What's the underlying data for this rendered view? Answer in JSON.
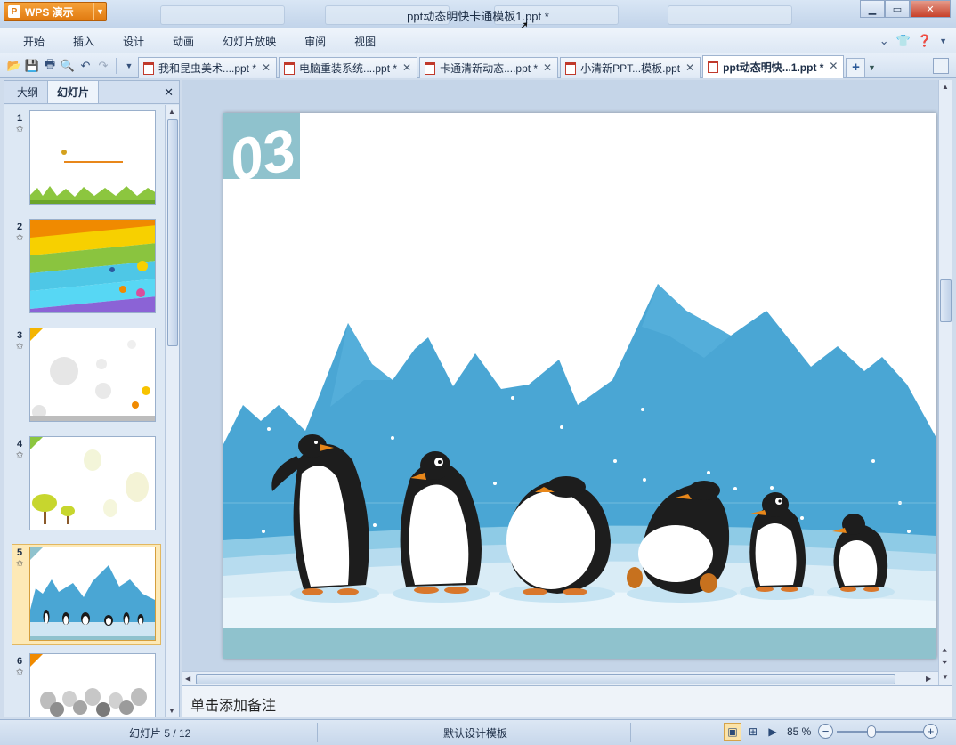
{
  "app": {
    "button_label": "WPS 演示",
    "logo_glyph": "P"
  },
  "window": {
    "title": "ppt动态明快卡通模板1.ppt *",
    "buttons": [
      "minimize",
      "maximize",
      "close"
    ]
  },
  "menu": {
    "items": [
      "开始",
      "插入",
      "设计",
      "动画",
      "幻灯片放映",
      "审阅",
      "视图"
    ]
  },
  "doc_tabs": [
    {
      "label": "我和昆虫美术....ppt *",
      "active": false
    },
    {
      "label": "电脑重装系统....ppt *",
      "active": false
    },
    {
      "label": "卡通清新动态....ppt *",
      "active": false
    },
    {
      "label": "小清新PPT...模板.ppt",
      "active": false
    },
    {
      "label": "ppt动态明快...1.ppt *",
      "active": true
    }
  ],
  "left_panel": {
    "tabs": [
      "大纲",
      "幻灯片"
    ],
    "active_tab": "幻灯片",
    "slides": [
      {
        "num": "1",
        "selected": false
      },
      {
        "num": "2",
        "selected": false
      },
      {
        "num": "3",
        "selected": false
      },
      {
        "num": "4",
        "selected": false
      },
      {
        "num": "5",
        "selected": true
      },
      {
        "num": "6",
        "selected": false
      }
    ]
  },
  "slide": {
    "number_label": "03"
  },
  "notes": {
    "placeholder": "单击添加备注"
  },
  "status": {
    "slide_info": "幻灯片 5 / 12",
    "template": "默认设计模板",
    "zoom": "85 %"
  },
  "colors": {
    "accent": "#e8871a",
    "sky": "#4aa6d4",
    "ice": "#cfe6f3",
    "badge": "#8fc2cd"
  }
}
